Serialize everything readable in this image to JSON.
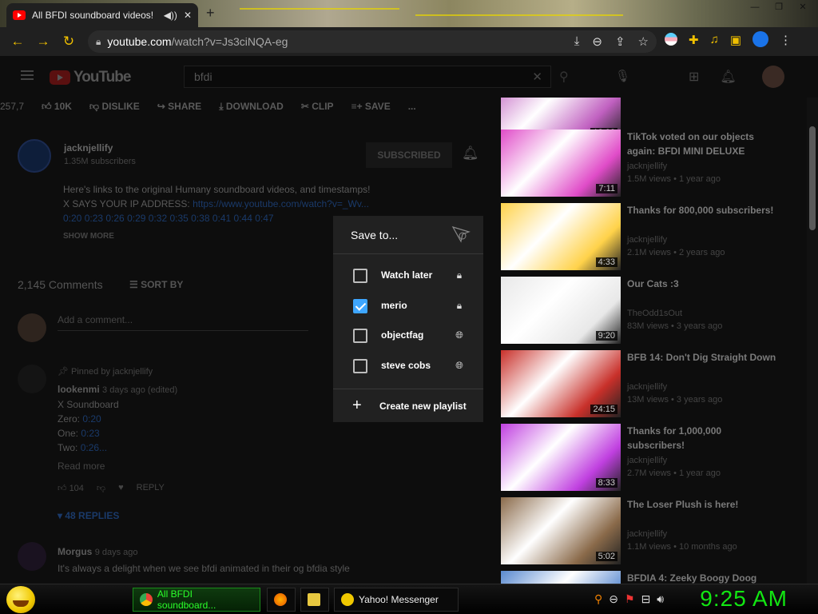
{
  "browser": {
    "tab_title": "All BFDI soundboard videos!",
    "url_host": "youtube.com",
    "url_path": "/watch?v=Js3ciNQA-eg"
  },
  "youtube": {
    "logo_text": "YouTube",
    "search_query": "bfdi"
  },
  "actions": {
    "views_partial": "257,7",
    "like_count": "10K",
    "dislike": "DISLIKE",
    "share": "SHARE",
    "download": "DOWNLOAD",
    "clip": "CLIP",
    "save": "SAVE",
    "more": "..."
  },
  "channel": {
    "name": "jacknjellify",
    "subscribers": "1.35M subscribers",
    "subscribed_label": "SUBSCRIBED"
  },
  "description": {
    "line1": "Here's links to the original Humany soundboard videos, and timestamps!",
    "line2_prefix": "X SAYS YOUR IP ADDRESS: ",
    "line2_link": "https://www.youtube.com/watch?v=_Wv...",
    "timestamps": "0:20 0:23 0:26 0:29 0:32 0:35 0:38 0:41 0:44 0:47",
    "show_more": "SHOW MORE"
  },
  "comments": {
    "count_label": "2,145 Comments",
    "sort_by": "SORT BY",
    "add_placeholder": "Add a comment...",
    "pinned_by": "Pinned by jacknjellify",
    "c1_author": "lookenmi",
    "c1_time": "3 days ago (edited)",
    "c1_line1": "X Soundboard",
    "c1_zero_label": "Zero: ",
    "c1_zero_ts": "0:20",
    "c1_one_label": "One: ",
    "c1_one_ts": "0:23",
    "c1_two_label": "Two: ",
    "c1_two_ts": "0:26...",
    "read_more": "Read more",
    "c1_likes": "104",
    "reply": "REPLY",
    "replies_label": "48 REPLIES",
    "c2_author": "Morgus",
    "c2_time": "9 days ago",
    "c2_text": "It's always a delight when we see bfdi animated in their og bfdia style"
  },
  "videos": [
    {
      "title": "",
      "channel": "",
      "meta": "",
      "duration": "12:02",
      "thumb_color": "#c060c0"
    },
    {
      "title": "TikTok voted on our objects again: BFDI MINI DELUXE",
      "channel": "jacknjellify",
      "meta": "1.5M views • 1 year ago",
      "duration": "7:11",
      "thumb_color": "#e04cc8"
    },
    {
      "title": "Thanks for 800,000 subscribers!",
      "channel": "jacknjellify",
      "meta": "2.1M views • 2 years ago",
      "duration": "4:33",
      "thumb_color": "#ffd24a"
    },
    {
      "title": "Our Cats :3",
      "channel": "TheOdd1sOut",
      "meta": "83M views • 3 years ago",
      "duration": "9:20",
      "thumb_color": "#e8e8e8"
    },
    {
      "title": "BFB 14: Don't Dig Straight Down",
      "channel": "jacknjellify",
      "meta": "13M views • 3 years ago",
      "duration": "24:15",
      "thumb_color": "#c8302a"
    },
    {
      "title": "Thanks for 1,000,000 subscribers!",
      "channel": "jacknjellify",
      "meta": "2.7M views • 1 year ago",
      "duration": "8:33",
      "thumb_color": "#c040e0"
    },
    {
      "title": "The Loser Plush is here!",
      "channel": "jacknjellify",
      "meta": "1.1M views • 10 months ago",
      "duration": "5:02",
      "thumb_color": "#8a6a4a"
    },
    {
      "title": "BFDIA 4: Zeeky Boogy Doog",
      "channel": "",
      "meta": "",
      "duration": "",
      "thumb_color": "#5a8ad0"
    }
  ],
  "modal": {
    "title": "Save to...",
    "playlists": [
      {
        "name": "Watch later",
        "checked": false,
        "privacy_icon": "lock-icon"
      },
      {
        "name": "merio",
        "checked": true,
        "privacy_icon": "lock-icon"
      },
      {
        "name": "objectfag",
        "checked": false,
        "privacy_icon": "globe-icon"
      },
      {
        "name": "steve cobs",
        "checked": false,
        "privacy_icon": "globe-icon"
      }
    ],
    "create_label": "Create new playlist"
  },
  "taskbar": {
    "chrome_label": "All BFDI soundboard...",
    "yahoo_label": "Yahoo! Messenger",
    "clock": "9:25 AM"
  },
  "colors": {
    "accent_checkbox": "#3ea6ff",
    "clock_green": "#12e612",
    "browser_accent": "#f0c000"
  }
}
